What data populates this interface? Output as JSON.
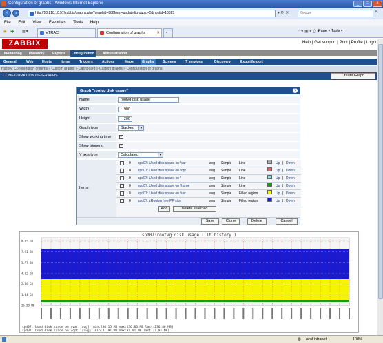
{
  "window": {
    "title": "Configuration of graphs - Windows Internet Explorer"
  },
  "addressbar": {
    "url": "http://10.210.10.57/zabbix/graphs.php?graphid=888form=update&groupid=5&hostid=10025",
    "search_placeholder": "Google"
  },
  "menu": [
    "File",
    "Edit",
    "View",
    "Favorites",
    "Tools",
    "Help"
  ],
  "tabs": [
    {
      "label": "eTRAC"
    },
    {
      "label": "Configuration of graphs"
    }
  ],
  "tab_tools": "Page ▾  Tools ▾",
  "zabbix": {
    "logo": "ZABBIX",
    "toplinks": "Help | Get support | Print | Profile | Logout",
    "mainnav": [
      "Monitoring",
      "Inventory",
      "Reports",
      "Configuration",
      "Administration"
    ],
    "subnav": [
      "General",
      "Web",
      "Hosts",
      "Items",
      "Triggers",
      "Actions",
      "Maps",
      "Graphs",
      "Screens",
      "IT services",
      "Discovery",
      "Export/Import"
    ],
    "breadcrumbs": "History: Configuration of items » Custom graphs » Dashboard » Custom graphs » Configuration of graphs",
    "section_title": "CONFIGURATION OF GRAPHS",
    "create_button": "Create Graph"
  },
  "form": {
    "header": "Graph \"rootvg disk usage\"",
    "name_label": "Name",
    "name_value": "rootvg disk usage",
    "width_label": "Width",
    "width_value": "900",
    "height_label": "Height",
    "height_value": "200",
    "type_label": "Graph type",
    "type_value": "Stacked",
    "working_label": "Show working time",
    "triggers_label": "Show triggers",
    "yaxis_label": "Y axis type",
    "yaxis_value": "Calculated",
    "items_label": "Items",
    "items": [
      {
        "sort": "0",
        "name": "spd07: Used disk space on /var",
        "func": "avg",
        "type": "Simple",
        "draw": "Line",
        "color": "#a9a9a9",
        "up": "Up",
        "down": "Down"
      },
      {
        "sort": "0",
        "name": "spd07: Used disk space on /opt",
        "func": "avg",
        "type": "Simple",
        "draw": "Line",
        "color": "#e06666",
        "up": "Up",
        "down": "Down"
      },
      {
        "sort": "0",
        "name": "spd07: Used disk space on /",
        "func": "avg",
        "type": "Simple",
        "draw": "Line",
        "color": "#9fd8d8",
        "up": "Up",
        "down": "Down"
      },
      {
        "sort": "0",
        "name": "spd07: Used disk space on /home",
        "func": "avg",
        "type": "Simple",
        "draw": "Line",
        "color": "#1a9a1a",
        "up": "Up",
        "down": "Down"
      },
      {
        "sort": "0",
        "name": "spd07: Used disk space on /usr",
        "func": "avg",
        "type": "Simple",
        "draw": "Filled region",
        "color": "#f5f500",
        "up": "Up",
        "down": "Down"
      },
      {
        "sort": "0",
        "name": "spd07: zRootvg free PP size",
        "func": "avg",
        "type": "Simple",
        "draw": "Filled region",
        "color": "#1a1ad0",
        "up": "Up",
        "down": "Down"
      }
    ],
    "add_button": "Add",
    "delete_selected_button": "Delete selected",
    "save_button": "Save",
    "clone_button": "Clone",
    "delete_button": "Delete",
    "cancel_button": "Cancel"
  },
  "graph": {
    "title": "spd07:rootvg disk usage  ( 1h history )",
    "y_ticks": [
      "8.65 GB",
      "7.21 GB",
      "5.77 GB",
      "4.33 GB",
      "2.88 GB",
      "1.44 GB",
      "25.53 MB"
    ],
    "legend": [
      "spd07: Used disk space on /var   [avg] [min:236.15 MB max:236.86 MB last:236.86 MB]",
      "spd07: Used disk space on /opt.  [avg] [min:31.91 MB max:31.91 MB last:31.91 MB]"
    ],
    "band_colors": [
      "#1a1ad0",
      "#f5f500",
      "#1a9a1a"
    ]
  },
  "statusbar": {
    "zone": "Local intranet",
    "zoom": "100%"
  }
}
